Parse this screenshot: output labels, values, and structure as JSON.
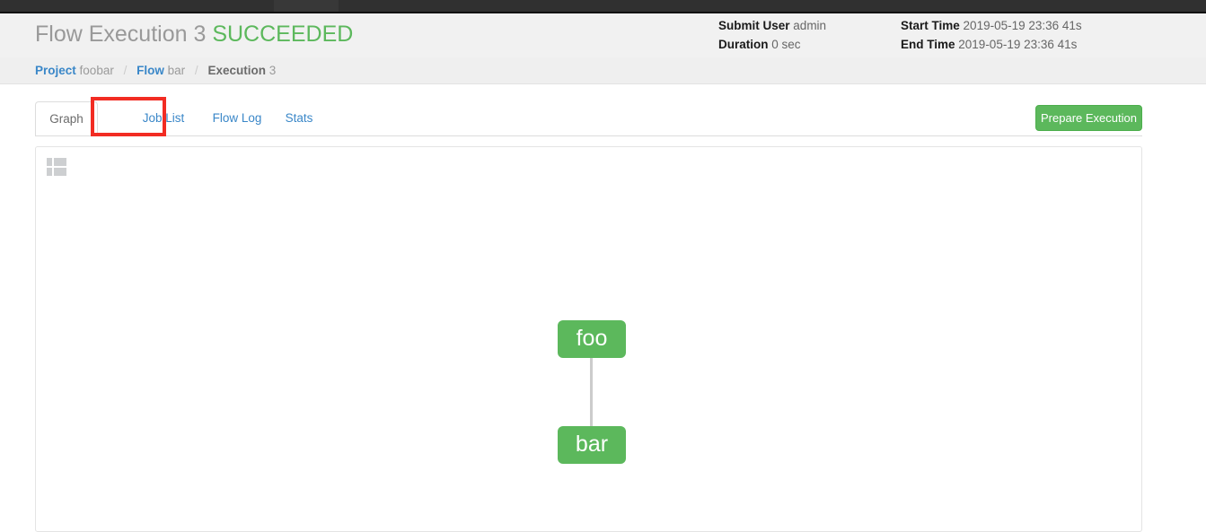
{
  "chrome": {
    "bar_color": "#303030",
    "active_tab_color": "#383838"
  },
  "header": {
    "title_prefix": "Flow Execution 3",
    "status": "SUCCEEDED",
    "status_color": "#5cb85c",
    "meta": {
      "submit_user_label": "Submit User",
      "submit_user_value": "admin",
      "duration_label": "Duration",
      "duration_value": "0 sec",
      "start_time_label": "Start Time",
      "start_time_value": "2019-05-19 23:36 41s",
      "end_time_label": "End Time",
      "end_time_value": "2019-05-19 23:36 41s"
    }
  },
  "breadcrumb": {
    "project_label": "Project",
    "project_value": "foobar",
    "flow_label": "Flow",
    "flow_value": "bar",
    "execution_label": "Execution",
    "execution_value": "3",
    "separator": "/"
  },
  "tabs": {
    "items": [
      {
        "label": "Graph",
        "active": true
      },
      {
        "label": "Job List",
        "active": false
      },
      {
        "label": "Flow Log",
        "active": false
      },
      {
        "label": "Stats",
        "active": false
      }
    ],
    "highlighted": "Job List",
    "highlight_color": "#f22c23"
  },
  "toolbar": {
    "prepare_label": "Prepare Execution",
    "prepare_color": "#5cb85c"
  },
  "graph": {
    "layout_icon": "grid-icon",
    "node_color": "#5cb85c",
    "edge_color": "#cccccc",
    "nodes": [
      {
        "id": "foo",
        "label": "foo"
      },
      {
        "id": "bar",
        "label": "bar"
      }
    ],
    "edges": [
      {
        "from": "foo",
        "to": "bar"
      }
    ]
  }
}
